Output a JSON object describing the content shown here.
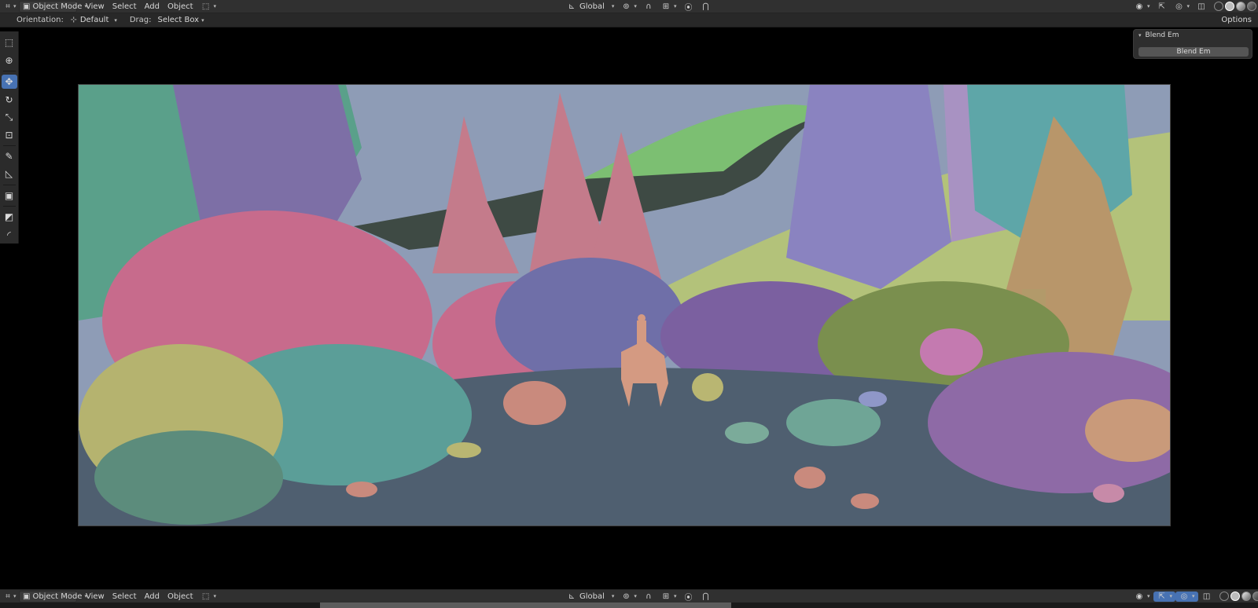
{
  "header": {
    "mode": "Object Mode",
    "menu": [
      "View",
      "Select",
      "Add",
      "Object"
    ],
    "transform_orientation": "Global"
  },
  "tool_settings": {
    "orientation_label": "Orientation:",
    "orientation_value": "Default",
    "drag_label": "Drag:",
    "drag_value": "Select Box",
    "options_label": "Options"
  },
  "toolbar": {
    "tools": [
      "select-box",
      "cursor",
      "move",
      "rotate",
      "scale",
      "transform",
      "annotate",
      "measure",
      "add-cube",
      "shader",
      "shrink"
    ],
    "active_tool": "move"
  },
  "redo_panel": {
    "title": "Blend Em",
    "operator_button": "Blend Em"
  },
  "bottom_header": {
    "mode": "Object Mode",
    "menu": [
      "View",
      "Select",
      "Add",
      "Object"
    ],
    "transform_orientation": "Global"
  },
  "colors": {
    "header_bg": "#303030",
    "accent": "#4772b3",
    "sky": "#8e9cb6",
    "ground": "#4f5f70"
  },
  "viewport": {
    "content": "3D forest scene render"
  }
}
